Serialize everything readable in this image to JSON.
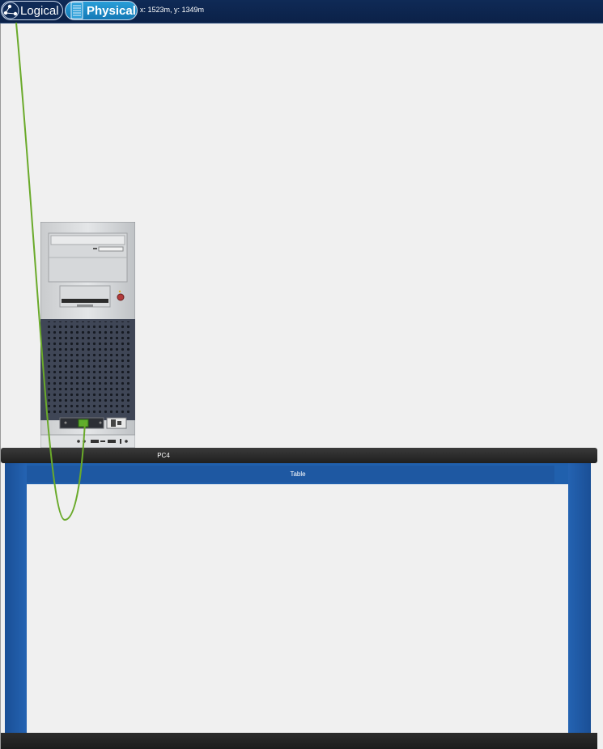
{
  "toolbar": {
    "logical_label": "Logical",
    "physical_label": "Physical",
    "coordinates": "x: 1523m, y: 1349m"
  },
  "workspace": {
    "device_label": "PC4",
    "table_label": "Table"
  },
  "colors": {
    "toolbar_bg": "#0f2a56",
    "physical_tab_active": "#1f8cc8",
    "cable": "#6aaa2a",
    "table_blue": "#1e58a2",
    "tabletop": "#262626"
  }
}
